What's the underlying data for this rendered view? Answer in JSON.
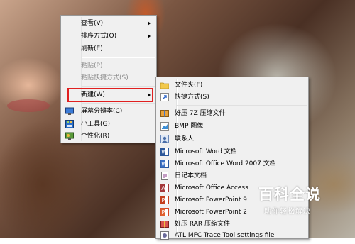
{
  "context_menu": {
    "items": [
      {
        "label": "查看(V)",
        "has_submenu": true,
        "disabled": false
      },
      {
        "label": "排序方式(O)",
        "has_submenu": true,
        "disabled": false
      },
      {
        "label": "刷新(E)",
        "has_submenu": false,
        "disabled": false
      },
      {
        "label": "粘贴(P)",
        "has_submenu": false,
        "disabled": true
      },
      {
        "label": "粘贴快捷方式(S)",
        "has_submenu": false,
        "disabled": true
      },
      {
        "label": "新建(W)",
        "has_submenu": true,
        "disabled": false
      },
      {
        "label": "屏幕分辨率(C)",
        "icon": "screen-resolution-icon"
      },
      {
        "label": "小工具(G)",
        "icon": "gadgets-icon"
      },
      {
        "label": "个性化(R)",
        "icon": "personalize-icon"
      }
    ]
  },
  "new_submenu": {
    "items": [
      {
        "label": "文件夹(F)",
        "icon": "folder-icon"
      },
      {
        "label": "快捷方式(S)",
        "icon": "shortcut-icon"
      },
      {
        "label": "好压 7Z 压缩文件",
        "icon": "haozip-7z-icon"
      },
      {
        "label": "BMP 图像",
        "icon": "bmp-image-icon"
      },
      {
        "label": "联系人",
        "icon": "contact-icon"
      },
      {
        "label": "Microsoft Word 文档",
        "icon": "word-doc-icon"
      },
      {
        "label": "Microsoft Office Word 2007 文档",
        "icon": "word-2007-doc-icon"
      },
      {
        "label": "日记本文档",
        "icon": "journal-doc-icon"
      },
      {
        "label": "Microsoft Office Access",
        "icon": "access-icon"
      },
      {
        "label": "Microsoft PowerPoint 9",
        "icon": "powerpoint-icon"
      },
      {
        "label": "Microsoft PowerPoint 2",
        "icon": "powerpoint-2007-icon"
      },
      {
        "label": "好压 RAR 压缩文件",
        "icon": "haozip-rar-icon"
      },
      {
        "label": "ATL MFC Trace Tool settings file",
        "icon": "atl-mfc-settings-icon"
      }
    ]
  },
  "watermark": {
    "title": "百科全说",
    "subtitle": "助你轻松解决"
  },
  "colors": {
    "menu_bg": "#f0f0f0",
    "highlight_border": "#e02020",
    "disabled_text": "#8b8b8b"
  }
}
